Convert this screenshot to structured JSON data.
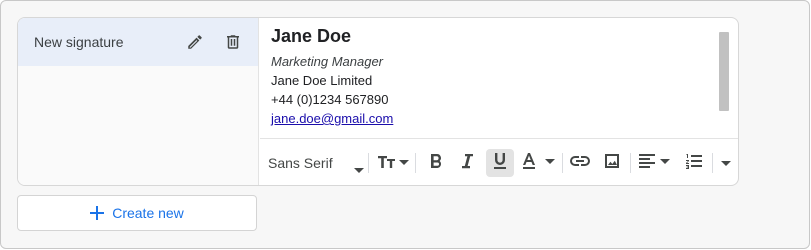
{
  "signature_list": {
    "items": [
      {
        "label": "New signature",
        "selected": true
      }
    ]
  },
  "signature": {
    "name": "Jane Doe",
    "title": "Marketing Manager",
    "company": "Jane Doe Limited",
    "phone": "+44 (0)1234 567890",
    "email": "jane.doe@gmail.com"
  },
  "toolbar": {
    "font_family": "Sans Serif",
    "buttons": [
      "font-size",
      "bold",
      "italic",
      "underline",
      "text-color",
      "link",
      "image",
      "align",
      "numbered-list",
      "more"
    ],
    "active": "underline"
  },
  "create_button": {
    "label": "Create new"
  },
  "colors": {
    "accent": "#1a73e8",
    "selected_row": "#e8eef9",
    "link": "#1a0dab"
  }
}
